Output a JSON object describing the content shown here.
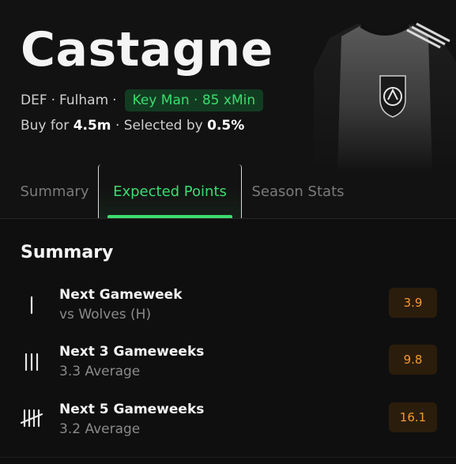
{
  "player": {
    "name": "Castagne",
    "position": "DEF",
    "team": "Fulham",
    "badge": "Key Man · 85 xMin",
    "buy_prefix": "Buy for",
    "price": "4.5m",
    "selected_prefix": "· Selected by",
    "selected_pct": "0.5%"
  },
  "tabs": [
    {
      "label": "Summary",
      "active": false
    },
    {
      "label": "Expected Points",
      "active": true
    },
    {
      "label": "Season Stats",
      "active": false
    }
  ],
  "section": {
    "title": "Summary"
  },
  "rows": [
    {
      "title": "Next Gameweek",
      "subtitle": "vs Wolves (H)",
      "value": "3.9",
      "icon": "tally-1-icon"
    },
    {
      "title": "Next 3 Gameweeks",
      "subtitle": "3.3 Average",
      "value": "9.8",
      "icon": "tally-3-icon"
    },
    {
      "title": "Next 5 Gameweeks",
      "subtitle": "3.2 Average",
      "value": "16.1",
      "icon": "tally-5-icon"
    }
  ],
  "colors": {
    "accent_green": "#3ddc6f",
    "value_orange": "#f29a2e",
    "background": "#0f0f0f"
  }
}
